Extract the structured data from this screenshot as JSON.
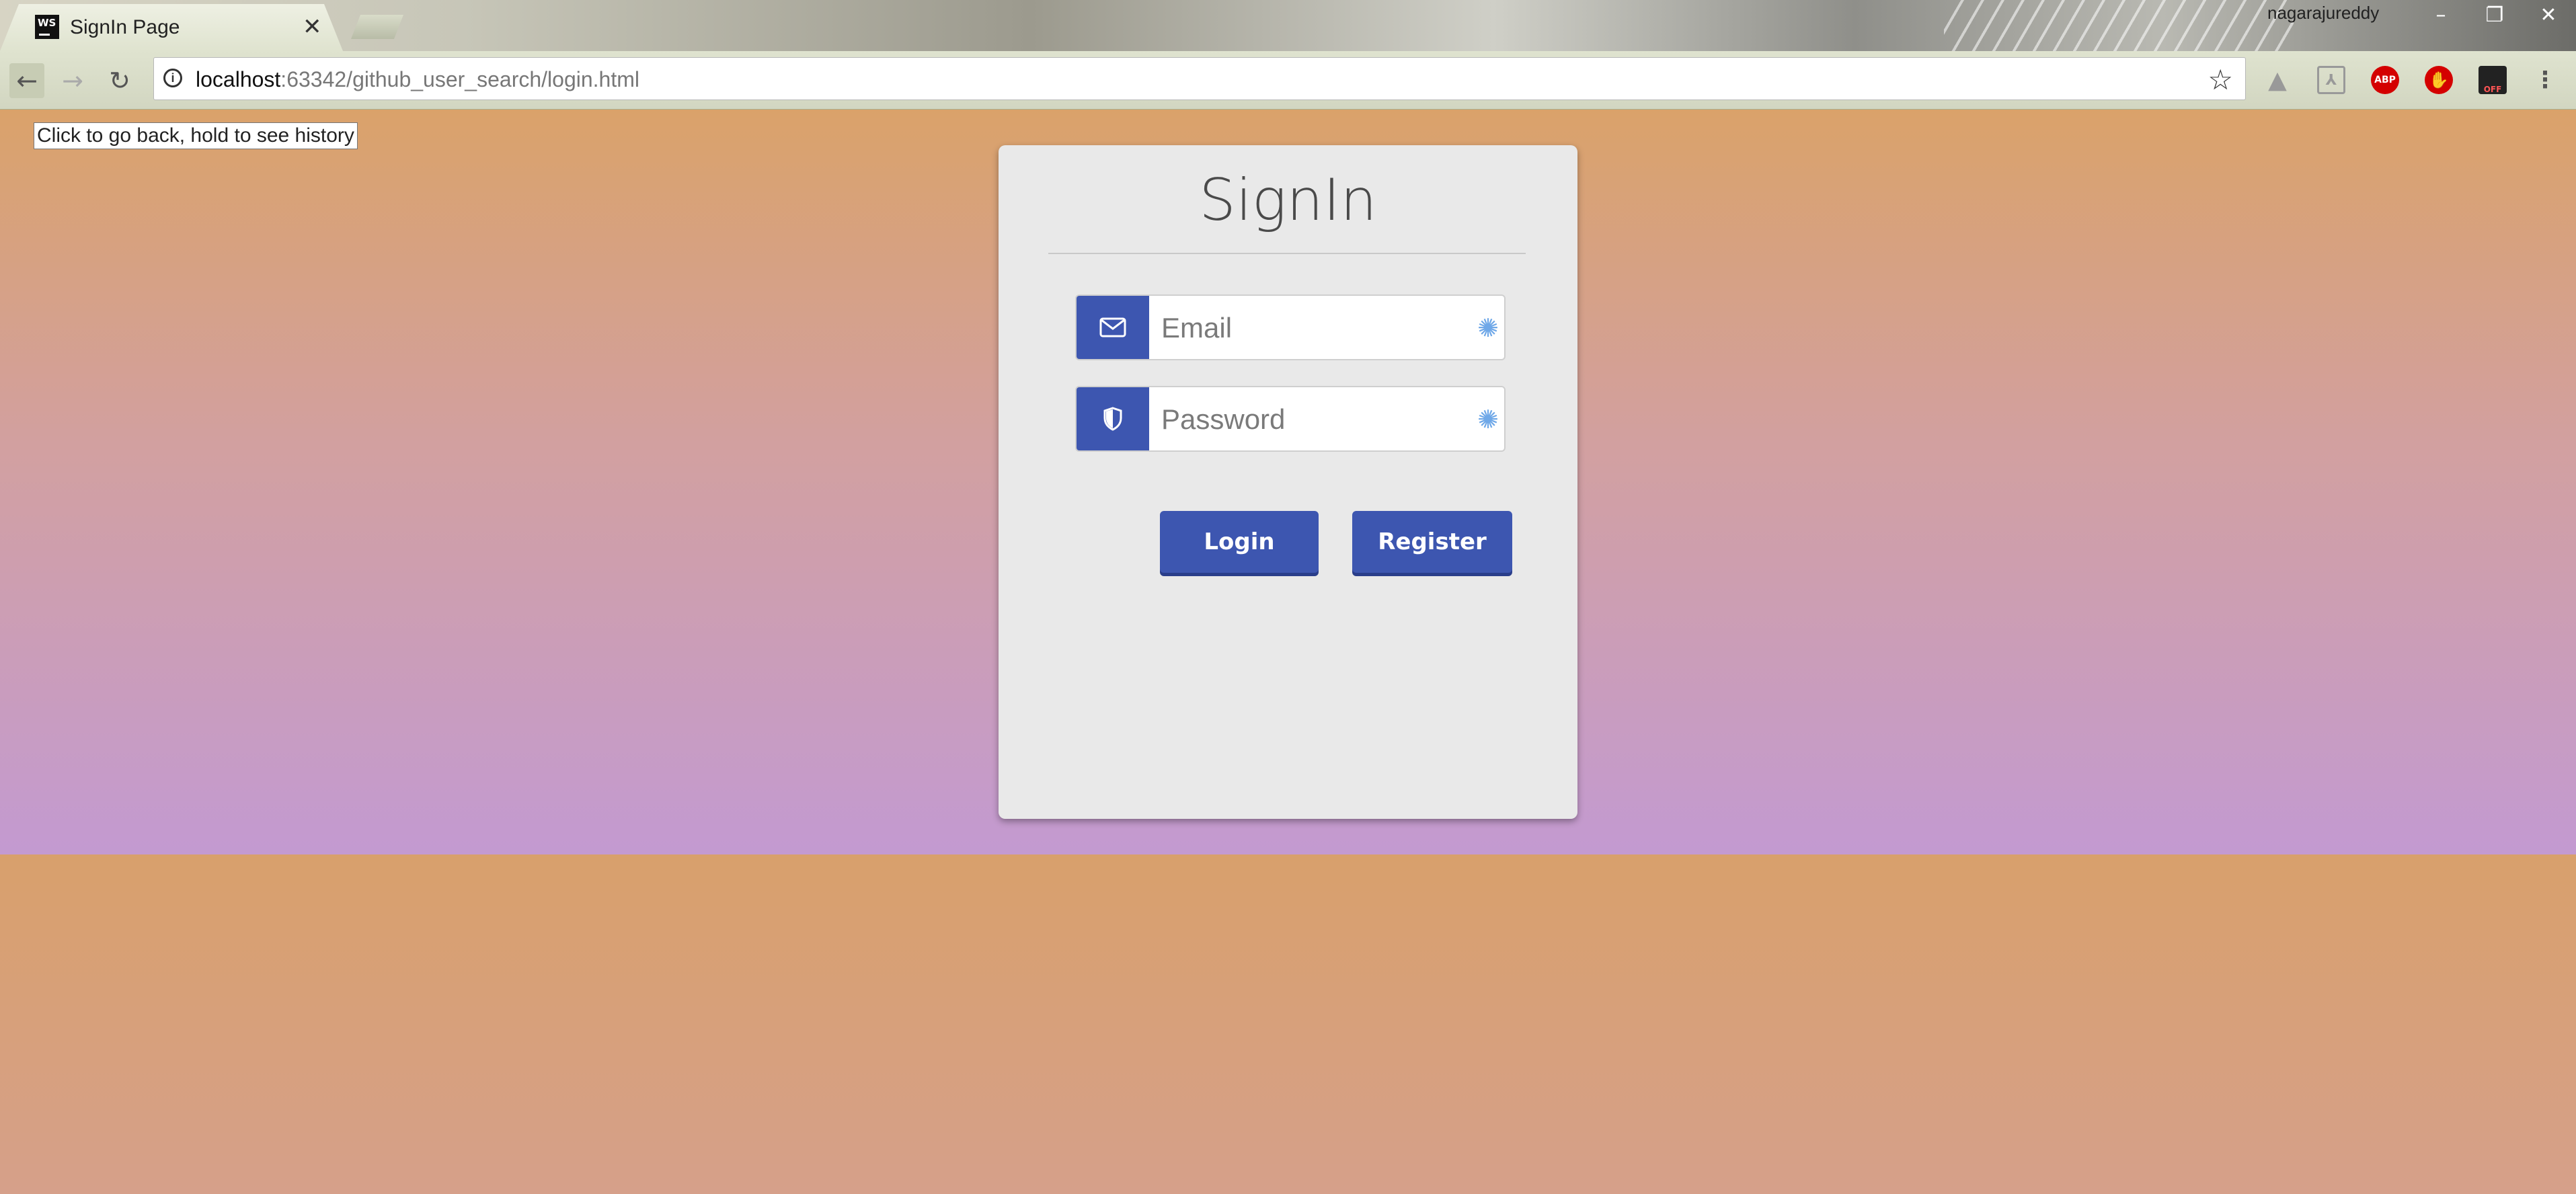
{
  "browser": {
    "tab": {
      "favicon_text": "WS",
      "title": "SignIn Page",
      "close_glyph": "✕"
    },
    "profile_name": "nagarajureddy",
    "window_controls": [
      "–",
      "❐",
      "✕"
    ],
    "address_bar": {
      "host": "localhost",
      "rest": ":63342/github_user_search/login.html"
    },
    "extensions": [
      "drive-icon",
      "pdf-icon",
      "adblock-plus-icon",
      "stop-hand-icon",
      "off-icon"
    ],
    "extension_labels": {
      "abp": "ABP",
      "off": "OFF"
    },
    "tooltip": "Click to go back, hold to see history"
  },
  "signin": {
    "title": "SignIn",
    "email_placeholder": "Email",
    "password_placeholder": "Password",
    "login_label": "Login",
    "register_label": "Register"
  },
  "colors": {
    "accent": "#3d56b0",
    "card": "#e9e9e9"
  }
}
